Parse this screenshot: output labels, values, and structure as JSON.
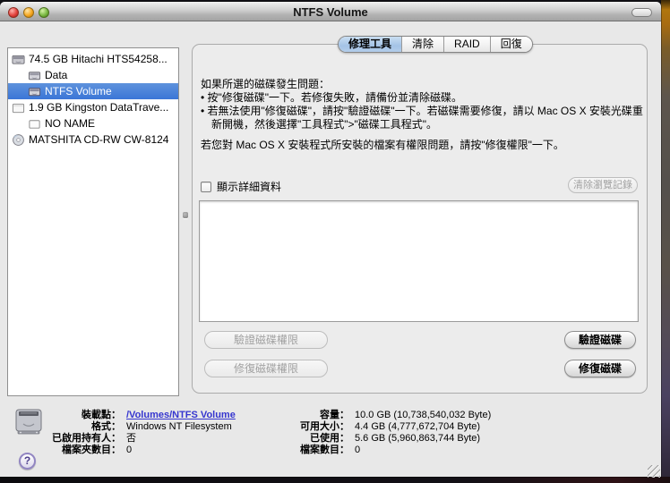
{
  "window": {
    "title": "NTFS Volume"
  },
  "sidebar": {
    "items": [
      {
        "label": "74.5 GB Hitachi HTS54258...",
        "icon": "internal-disk",
        "selected": false
      },
      {
        "label": "Data",
        "icon": "volume",
        "selected": false
      },
      {
        "label": "NTFS Volume",
        "icon": "volume",
        "selected": true
      },
      {
        "label": "1.9 GB Kingston DataTrave...",
        "icon": "external-disk",
        "selected": false
      },
      {
        "label": "NO NAME",
        "icon": "external-volume",
        "selected": false
      },
      {
        "label": "MATSHITA CD-RW CW-8124",
        "icon": "optical-drive",
        "selected": false
      }
    ]
  },
  "tabs": [
    {
      "label": "修理工具",
      "selected": true
    },
    {
      "label": "清除",
      "selected": false
    },
    {
      "label": "RAID",
      "selected": false
    },
    {
      "label": "回復",
      "selected": false
    }
  ],
  "first_aid": {
    "intro": "如果所選的磁碟發生問題：",
    "bullets": [
      "• 按\"修復磁碟\"一下。若修復失敗，請備份並清除磁碟。",
      "• 若無法使用\"修復磁碟\"，請按\"驗證磁碟\"一下。若磁碟需要修復，請以 Mac OS X 安裝光碟重新開機，然後選擇\"工具程式\">\"磁碟工具程式\"。"
    ],
    "note": "若您對 Mac OS X 安裝程式所安裝的檔案有權限問題，請按\"修復權限\"一下。",
    "show_details": "顯示詳細資料",
    "clear_history": "清除瀏覽記錄",
    "verify_permissions": "驗證磁碟權限",
    "repair_permissions": "修復磁碟權限",
    "verify_disk": "驗證磁碟",
    "repair_disk": "修復磁碟"
  },
  "footer": {
    "help": "?",
    "left": [
      {
        "label": "裝載點：",
        "value": "/Volumes/NTFS Volume"
      },
      {
        "label": "格式：",
        "value": "Windows NT Filesystem"
      },
      {
        "label": "已啟用持有人：",
        "value": "否"
      },
      {
        "label": "檔案夾數目：",
        "value": "0"
      }
    ],
    "right": [
      {
        "label": "容量：",
        "value": "10.0 GB (10,738,540,032 Byte)"
      },
      {
        "label": "可用大小：",
        "value": "4.4 GB (4,777,672,704 Byte)"
      },
      {
        "label": "已使用：",
        "value": "5.6 GB (5,960,863,744 Byte)"
      },
      {
        "label": "檔案數目：",
        "value": "0"
      }
    ]
  },
  "colors": {
    "selection": "#3b76d7",
    "link": "#3535cf",
    "tab_selected": "#a4c3e6"
  }
}
